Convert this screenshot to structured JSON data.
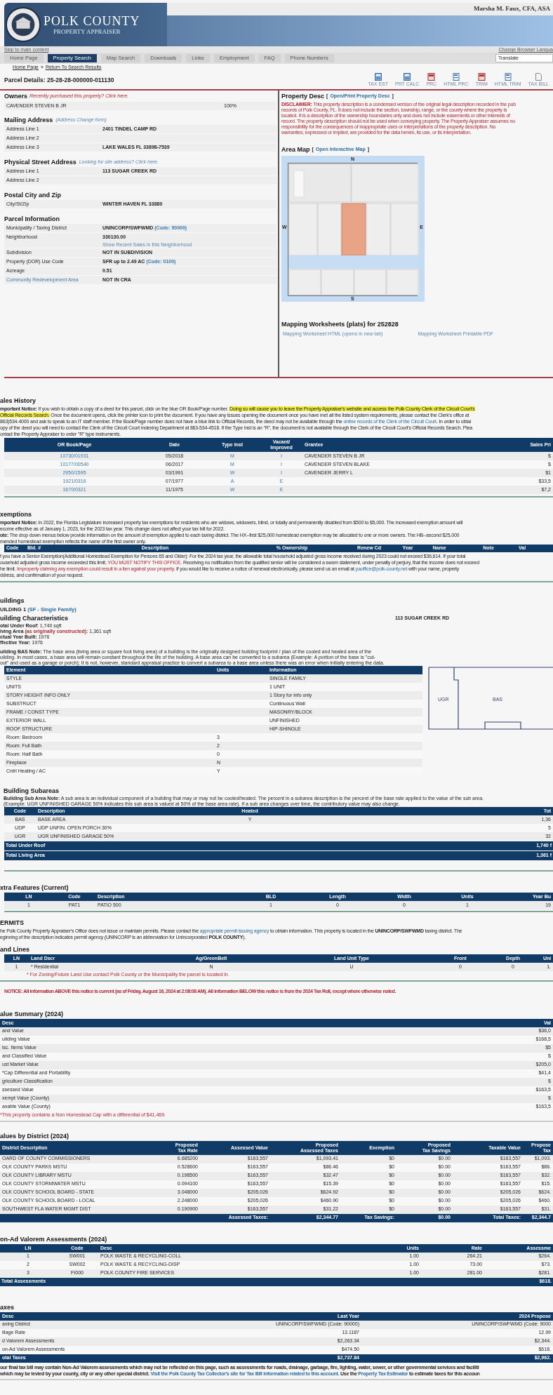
{
  "banner": {
    "title": "POLK COUNTY",
    "subtitle": "PROPERTY APPRAISER",
    "appraiser": "Marsha M. Faux, CFA, ASA"
  },
  "skip_link": "Skip to main content",
  "language_link": "Change Browser Langua",
  "nav": [
    {
      "label": "Home Page",
      "selected": false
    },
    {
      "label": "Property Search",
      "selected": true
    },
    {
      "label": "Map Search",
      "selected": false
    },
    {
      "label": "Downloads",
      "selected": false
    },
    {
      "label": "Links",
      "selected": false
    },
    {
      "label": "Employment",
      "selected": false
    },
    {
      "label": "FAQ",
      "selected": false
    },
    {
      "label": "Phone Numbers",
      "selected": false
    }
  ],
  "translate": "Translate",
  "breadcrumb": {
    "home": "Home Page",
    "separator": "»",
    "back": "Return To Search Results"
  },
  "parcel_title": "Parcel Details: 25-28-28-000000-011130",
  "tools": [
    {
      "label": "TAX EST",
      "kind": "calc"
    },
    {
      "label": "PRT CALC",
      "kind": "calc"
    },
    {
      "label": "PRC",
      "kind": "pdf"
    },
    {
      "label": "HTML PRC",
      "kind": "html"
    },
    {
      "label": "TRIM",
      "kind": "pdf"
    },
    {
      "label": "HTML TRIM",
      "kind": "html"
    },
    {
      "label": "TAX BILL",
      "kind": "doc"
    }
  ],
  "owners": {
    "title": "Owners",
    "note": "Recently purchased this property? Click here.",
    "rows": [
      {
        "name": "CAVENDER STEVEN B JR",
        "share": "100%"
      }
    ]
  },
  "mailing": {
    "title": "Mailing Address",
    "note": "(Address Change form)",
    "rows": [
      {
        "label": "Address Line 1",
        "value": "2401 TINDEL CAMP RD"
      },
      {
        "label": "Address Line 2"
      },
      {
        "label": "Address Line 3",
        "value": "LAKE WALES FL 33898-7539"
      }
    ]
  },
  "physical": {
    "title": "Physical Street Address",
    "note": "Looking for site address? Click here.",
    "rows": [
      {
        "label": "Address Line 1",
        "value": "113 SUGAR CREEK RD"
      },
      {
        "label": "Address Line 2"
      }
    ]
  },
  "postal": {
    "title": "Postal City and Zip",
    "rows": [
      {
        "label": "City/St/Zip",
        "value": "WINTER HAVEN FL 33880"
      }
    ]
  },
  "parcel_info": {
    "title": "Parcel Information",
    "rows": [
      {
        "label": "Municipality / Taxing District",
        "kind": "plain",
        "value": "UNINCORP/SWFWMD",
        "code": "(Code: 90000)"
      },
      {
        "label": "Neighborhood",
        "kind": "plain",
        "value": "330130.00",
        "link": "Show Recent Sales in this Neighborhood"
      },
      {
        "label": "Subdivision",
        "kind": "plain",
        "value": "NOT IN SUBDIVISION"
      },
      {
        "label": "Property (DOR) Use Code",
        "kind": "plain",
        "value": "SFR up to 2.49 AC",
        "code": "(Code: 0100)"
      },
      {
        "label": "Acreage",
        "kind": "plain",
        "value": "0.51"
      },
      {
        "label": "Community Redevelopment Area",
        "kind": "link",
        "value": "NOT IN CRA"
      }
    ]
  },
  "property_desc": {
    "title": "Property Desc",
    "bracket_open": "[",
    "link": "Open/Print Property Desc",
    "bracket_close": "]",
    "disclaimer": [
      "**DISCLAIMER:** This property description is a condensed version of the original legal description recorded in the pub",
      "records of Polk County, FL. It does not include the section, township, range, or the county where the property is",
      "located. It is a description of the ownership boundaries only and does not include easements or other interests of",
      "record. The property description should not be used when conveying property. The Property Appraiser assumes no",
      "responsibility for the consequences of inappropriate uses or interpretations of the property description. No",
      "warranties, expressed or implied, are provided for the data herein, its use, or its interpretation."
    ]
  },
  "area_map": {
    "title": "Area Map",
    "bracket_open": "[",
    "link": "Open Interactive Map",
    "bracket_close": "]",
    "north": "N",
    "south": "S",
    "west": "W",
    "east": "E"
  },
  "mapping": {
    "title": "Mapping Worksheets (plats) for 252828",
    "links": [
      "Mapping Worksheet HTML (opens in new tab)",
      "Mapping Worksheet Printable PDF"
    ]
  },
  "sales": {
    "title": "ales History",
    "notice": [
      [
        {
          "text": "mportant Notice:",
          "kind": "bold"
        },
        " If you wish to obtain a copy of a deed for this parcel, click on the blue OR Book/Page number. ",
        {
          "text": "Doing so will cause you to leave the Property Appraiser's website and access the Polk County Clerk of the Circuit Court's",
          "kind": "mark"
        }
      ],
      [
        {
          "text": "Official Records Search.",
          "kind": "mark"
        },
        " Once the document opens, click the printer icon to print the document. If you have any issues opening the document once you have met all the listed system requirements, please contact the Clerk's office at"
      ],
      [
        "863)534-4000 and ask to speak to an IT staff member. If the Book/Page number does not have a blue link to Official Records, the deed may not be available through the ",
        {
          "text": "online records of the Clerk of the Circuit Court",
          "kind": "link"
        },
        ". In order to obtai"
      ],
      [
        "opy of the deed you will need to contact the Clerk of the Circuit Court Indexing Department at 863-534-4516. If the Type Inst is an \"R\", the document is not available through the Clerk of the Circuit Court's Official Records Search. Plea"
      ],
      [
        "ontact the Property Appraiser to order \"R\" type instruments."
      ]
    ],
    "columns": [
      "OR Book/Page",
      "Date",
      "Type Inst",
      "Vacant/\nImproved",
      "Grantee",
      "Sales Pri"
    ],
    "rows": [
      {
        "book": "10730/01931",
        "date": "05/2018",
        "type": "M",
        "vacant": "I",
        "grantee": "CAVENDER STEVEN B JR",
        "price": "$"
      },
      {
        "book": "10177/00540",
        "date": "06/2017",
        "type": "M",
        "vacant": "I",
        "grantee": "CAVENDER STEVEN BLAKE",
        "price": "$"
      },
      {
        "book": "2950/1595",
        "date": "03/1991",
        "type": "W",
        "vacant": "I",
        "grantee": "CAVENDER JERRY L",
        "price": "$1"
      },
      {
        "book": "1921/0316",
        "date": "07/1977",
        "type": "A",
        "vacant": "E",
        "price": "$33,5"
      },
      {
        "book": "1670/0321",
        "date": "11/1975",
        "type": "W",
        "vacant": "E",
        "price": "$7,2"
      }
    ]
  },
  "exemptions": {
    "title": "xemptions",
    "notice": [
      [
        {
          "text": "mportant Notice:",
          "kind": "bold"
        },
        " In 2022, the Florida Legislature increased property tax exemptions for residents who are widows, widowers, blind, or totally and permanently disabled from $500 to $5,000. The increased exemption amount will"
      ],
      [
        "ecome effective as of January 1, 2023, for the 2023 tax year. This change does not affect your tax bill for 2022."
      ],
      [
        {
          "text": "ote:",
          "kind": "bold"
        },
        "  The drop down menus below provide information on the amount of exemption applied to each taxing district. The HX--first $25,000 homestead exemption may be allocated to one or more owners. The HB--second $25,000"
      ],
      [
        "mended homestead exemption reflects the name of the first owner only."
      ]
    ],
    "columns": [
      "Code",
      "Bld. #",
      "Description",
      "% Ownership",
      "Renew Cd",
      "Year",
      "Name",
      "Note",
      "Val"
    ],
    "senior": [
      [
        "f you have a Senior Exemption(Additional Homestead Exemption for Persons 65 and Older):   For the 2024 tax year, the allowable total household adjusted gross income received during 2023 could not exceed $36,614.   If your total"
      ],
      [
        "ousehold adjusted gross income exceeded this limit, ",
        {
          "text": "YOU MUST NOTIFY THIS OFFICE.",
          "kind": "red"
        },
        "  Receiving no notification from the qualified senior will be considered a sworn statement, under penalty of perjury, that the income does not exceed"
      ],
      [
        "he limit. ",
        {
          "text": "Improperly claiming any exemption could result in a lien against your property.",
          "kind": "red"
        },
        "  If you would like to receive a notice of renewal electronically, please send us an email at ",
        {
          "text": "paoffice@polk-county.net",
          "kind": "link"
        },
        " with your name, property"
      ],
      [
        "ddress, and confirmation of your request."
      ]
    ]
  },
  "buildings": {
    "title": "uildings",
    "building": "UILDING 1",
    "building_type": "(SF - Single Family)",
    "characteristics_title": "uilding Characteristics",
    "address": "113 SUGAR CREEK RD",
    "stats": [
      [
        {
          "text": "otal Under Roof:",
          "kind": "bold"
        },
        " 1,740 sqft"
      ],
      [
        {
          "text": "iving Area ",
          "kind": "bold"
        },
        {
          "text": "(as originally constructed):",
          "kind": "redbold"
        },
        " 1,361 sqft"
      ],
      [
        {
          "text": "ctual Year Built:",
          "kind": "bold"
        },
        " 1976"
      ],
      [
        {
          "text": "ffective Year:",
          "kind": "bold"
        },
        " 1976"
      ]
    ],
    "bas_note": [
      [
        {
          "text": "uilding BAS Note:",
          "kind": "bold"
        },
        "   The base area (living area or square foot living area) of a building is the originally designed building footprint / plan of the cooled and heated area of the"
      ],
      [
        "uilding.  In most cases, a base area will remain constant throughout the life of the building.  A base area can be converted to a subarea (Example: A portion of the base is \"cut-"
      ],
      [
        "out\" and used as a garage or porch); It is not, however, standard appraisal practice to convert a subarea to a base area unless there was an error when initially entering the data."
      ]
    ],
    "columns": [
      "Element",
      "Units",
      "Information"
    ],
    "elements": [
      {
        "element": "STYLE",
        "info": "SINGLE FAMILY"
      },
      {
        "element": "UNITS",
        "info": "1 UNIT"
      },
      {
        "element": "STORY HEIGHT INFO ONLY",
        "info": "1 Story for info only"
      },
      {
        "element": "SUBSTRUCT",
        "info": "Continuous Wall"
      },
      {
        "element": "FRAME / CONST TYPE",
        "info": "MASONRY/BLOCK"
      },
      {
        "element": "EXTERIOR WALL",
        "info": "UNFINISHED"
      },
      {
        "element": "ROOF STRUCTURE",
        "info": "HIP-SHINGLE"
      },
      {
        "element": "Room: Bedroom",
        "units": "3"
      },
      {
        "element": "Room: Full Bath",
        "units": "2"
      },
      {
        "element": "Room: Half Bath",
        "units": "0"
      },
      {
        "element": "Fireplace",
        "units": "N"
      },
      {
        "element": "Cntrl Heating / AC",
        "units": "Y"
      }
    ],
    "sketch_labels": [
      "UGR",
      "BAS"
    ]
  },
  "subareas": {
    "title": "Building Subareas",
    "note": [
      [
        {
          "text": "Building Sub Area Note:",
          "kind": "bold"
        },
        "   A sub area is an individual component of a building that may or may not be cooled/heated.  The percent in a subarea description is the percent of the base rate applied to the value of the sub area."
      ],
      [
        "(Example: UGR UNFINISHED GARAGE 50% indicates this sub area is valued at 50% of the base area rate). If a sub area changes over time, the contributory value may also change."
      ]
    ],
    "columns": [
      "Code",
      "Description",
      "Heated",
      "Tot"
    ],
    "rows": [
      {
        "code": "BAS",
        "description": "BASE AREA",
        "heated": "Y",
        "total": "1,36"
      },
      {
        "code": "UDP",
        "description": "UDP UNFIN. OPEN PORCH 30%",
        "total": "5"
      },
      {
        "code": "UGR",
        "description": "UGR UNFINISHED GARAGE 50%",
        "total": "32"
      }
    ],
    "totals": [
      {
        "label": "Total Under Roof",
        "value": "1,740 f"
      },
      {
        "label": "Total Living Area",
        "value": "1,361 f"
      }
    ]
  },
  "extra_features": {
    "title": "xtra Features (Current)",
    "columns": [
      "LN",
      "Code",
      "Description",
      "BLD",
      "Length",
      "Width",
      "Units",
      "Year Bu"
    ],
    "rows": [
      [
        "1",
        "PAT1",
        "PATIO 500",
        "1",
        "0",
        "0",
        "1",
        "19"
      ]
    ]
  },
  "permits": {
    "title": "ERMITS",
    "text": [
      [
        "he Polk County Property Appraiser's Office does not issue or maintain permits.   Please contact the ",
        {
          "text": "appropriate permit issuing agency",
          "kind": "link"
        },
        " to obtain information.   This property is located in the ",
        {
          "text": "UNINCORP/SWFWMD",
          "kind": "bold"
        },
        "  taxing district. The"
      ],
      [
        "eginning of the description indicates permit agency (UNINCORP is an abbreviation for Unincorporated ",
        {
          "text": "POLK COUNTY",
          "kind": "bold"
        },
        ")."
      ]
    ]
  },
  "land_lines": {
    "title": "and Lines",
    "columns": [
      "LN",
      "Land Dscr",
      "Ag/GreenBelt",
      "Land Unit Type",
      "Front",
      "Depth",
      "Uni"
    ],
    "rows": [
      [
        "1",
        "* Residential",
        "N",
        "U",
        "0",
        "0",
        "1."
      ]
    ],
    "note": "* For Zoning/Future Land Use contact Polk County or the Municipality the parcel is located in."
  },
  "roll_notice": "NOTICE:  All information ABOVE this notice is current (as of Friday, August 16, 2024 at 2:08:08 AM).  All information BELOW this notice is from the 2024 Tax Roll, except where otherwise noted.",
  "value_summary": {
    "title": "alue Summary (2024)",
    "columns": [
      "Desc",
      "Val"
    ],
    "rows": [
      [
        "and Value",
        "$36,0"
      ],
      [
        "uilding Value",
        "$168,5"
      ],
      [
        "isc. Items Value",
        "$5"
      ],
      [
        "and Classified Value",
        "$"
      ],
      [
        "ust Market Value",
        "$205,0"
      ],
      [
        "*Cap Differential and Portability",
        "$41,4"
      ],
      [
        "griculture Classification",
        "$"
      ],
      [
        "ssessed Value",
        "$163,5"
      ],
      [
        "xempt Value (County)",
        "$"
      ],
      [
        "axable Value (County)",
        "$163,5"
      ]
    ],
    "note": "*This property contains a Non Homestead Cap with a differential of $41,469."
  },
  "district_values": {
    "title": "alues by District (2024)",
    "columns": [
      "District Description",
      "Proposed\nTax Rate",
      "Assessed Value",
      "Proposed\nAssessed Taxes",
      "Exemption",
      "Proposed\nTax Savings",
      "Taxable Value",
      "Propose\nTax"
    ],
    "rows": [
      [
        "OARD OF COUNTY COMMISSIONERS",
        "6.685200",
        "$163,557",
        "$1,093.41",
        "$0",
        "$0.00",
        "$163,557",
        "$1,093."
      ],
      [
        "OLK COUNTY PARKS MSTU",
        "0.528600",
        "$163,557",
        "$86.46",
        "$0",
        "$0.00",
        "$163,557",
        "$86."
      ],
      [
        "OLK COUNTY LIBRARY MSTU",
        "0.198500",
        "$163,557",
        "$32.47",
        "$0",
        "$0.00",
        "$163,557",
        "$32."
      ],
      [
        "OLK COUNTY STORMWATER MSTU",
        "0.094100",
        "$163,557",
        "$15.39",
        "$0",
        "$0.00",
        "$163,557",
        "$15."
      ],
      [
        "OLK COUNTY SCHOOL BOARD - STATE",
        "3.048000",
        "$205,026",
        "$624.92",
        "$0",
        "$0.00",
        "$205,026",
        "$624."
      ],
      [
        "OLK COUNTY SCHOOL BOARD - LOCAL",
        "2.248000",
        "$205,026",
        "$460.90",
        "$0",
        "$0.00",
        "$205,026",
        "$460."
      ],
      [
        "SOUTHWEST FLA WATER MGMT DIST",
        "0.190900",
        "$163,557",
        "$31.22",
        "$0",
        "$0.00",
        "$163,557",
        "$31."
      ]
    ],
    "totals": [
      "Assessed Taxes:",
      "$2,344.77",
      "Tax Savings:",
      "$0.00",
      "Total Taxes:",
      "$2,344.7"
    ]
  },
  "non_ad_valorem": {
    "title": "on-Ad Valorem Assessments (2024)",
    "columns": [
      "LN",
      "Code",
      "Desc",
      "Units",
      "Rate",
      "Assessme"
    ],
    "rows": [
      [
        "1",
        "SW001",
        "POLK WASTE & RECYCLING-COLL",
        "1.00",
        "264.21",
        "$264."
      ],
      [
        "2",
        "SW002",
        "POLK WASTE & RECYCLING-DISP",
        "1.00",
        "73.00",
        "$73."
      ],
      [
        "3",
        "FI000",
        "POLK COUNTY FIRE SERVICES",
        "1.00",
        "281.00",
        "$281."
      ]
    ],
    "total": {
      "label": "Total Assessments",
      "value": "$618."
    }
  },
  "taxes": {
    "title": "axes",
    "columns": [
      "Desc",
      "Last Year",
      "2024 Propose"
    ],
    "rows": [
      [
        "axing District",
        "UNINCORP/SWFWMD (Code: 90000)",
        "UNINCORP/SWFWMD (Code: 9000"
      ],
      [
        "illage Rate",
        "13.1187",
        "12.99"
      ],
      [
        "d Valorem Assessments",
        "$2,263.34",
        "$2,344."
      ],
      [
        "on-Ad Valorem Assessments",
        "$474.50",
        "$618."
      ]
    ],
    "total": [
      "otal Taxes",
      "$2,737.84",
      "$2,962."
    ],
    "final": [
      [
        "our final tax bill may contain Non-Ad Valorem assessments which may not be reflected on this page, such as assessments for roads, drainage, garbage, fire, lighting, water, sewer, or other governmental services and faciliti"
      ],
      [
        "which may be levied by your county, city or any other special district.  ",
        {
          "text": "Visit the Polk County Tax Collector's site for Tax Bill information related to this account.",
          "kind": "link"
        },
        "  Use the ",
        {
          "text": "Property Tax Estimator",
          "kind": "link"
        },
        " to estimate taxes for this accoun"
      ]
    ]
  }
}
